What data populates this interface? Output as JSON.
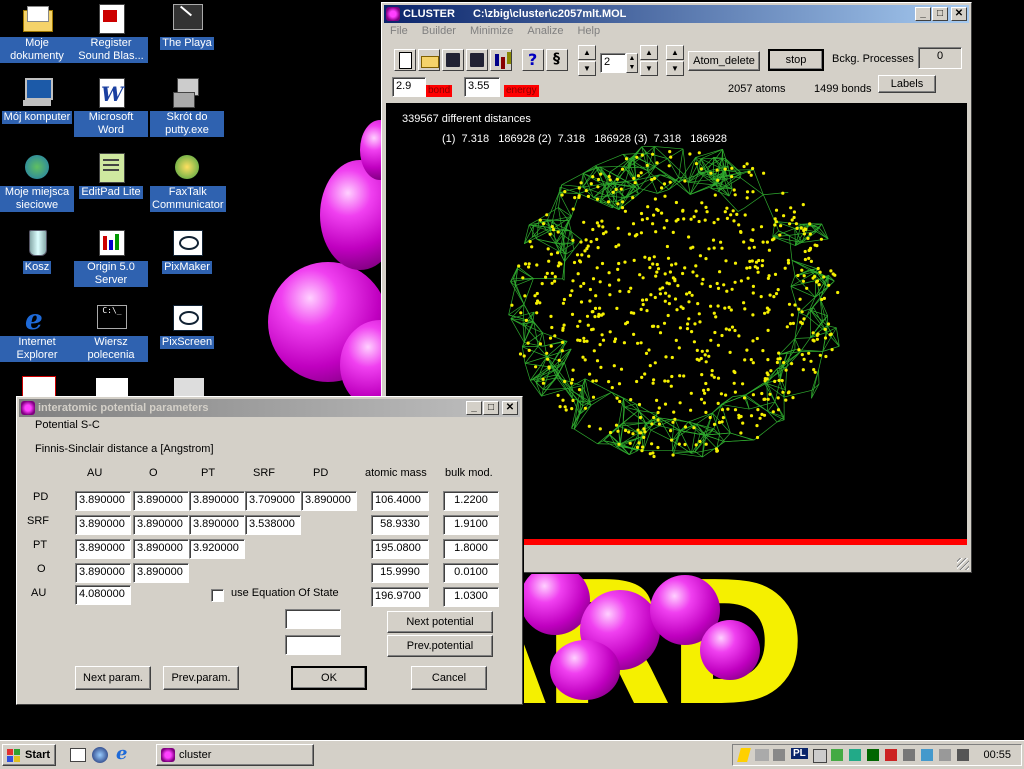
{
  "desktop": {
    "icons": [
      {
        "label": "Moje dokumenty"
      },
      {
        "label": "Register Sound Blas..."
      },
      {
        "label": "The Playa"
      },
      {
        "label": "Mój komputer"
      },
      {
        "label": "Microsoft Word"
      },
      {
        "label": "Skrót do putty.exe"
      },
      {
        "label": "Moje miejsca sieciowe"
      },
      {
        "label": "EditPad Lite"
      },
      {
        "label": "FaxTalk Communicator"
      },
      {
        "label": "Kosz"
      },
      {
        "label": "Origin 5.0 Server"
      },
      {
        "label": "PixMaker"
      },
      {
        "label": "Internet Explorer"
      },
      {
        "label": "Wiersz polecenia"
      },
      {
        "label": "PixScreen"
      }
    ],
    "bg_text": "ARD"
  },
  "cluster": {
    "title": "CLUSTER",
    "path": "C:\\zbig\\cluster\\c2057mlt.MOL",
    "menu": [
      "File",
      "Builder",
      "Minimize",
      "Analize",
      "Help"
    ],
    "spin_value": "2",
    "atom_delete": "Atom_delete",
    "stop": "stop",
    "bckg_label": "Bckg. Processes",
    "bckg_value": "0",
    "labels_button": "Labels",
    "bond_value": "2.9",
    "bond_label": "bond",
    "energy_value": "3.55",
    "energy_label": "energy",
    "atoms": "2057 atoms",
    "bonds": "1499 bonds",
    "distances": "339567 different distances",
    "distance_line": "(1)  7.318   186928 (2)  7.318   186928 (3)  7.318   186928",
    "colors": {
      "bond": "#2faa2f",
      "atom": "#f5f000",
      "red": "#ff0000"
    }
  },
  "dialog": {
    "title": "interatomic potential parameters",
    "potential": "Potential S-C",
    "description": "Finnis-Sinclair distance a [Angstrom]",
    "col_headers": [
      "AU",
      "O",
      "PT",
      "SRF",
      "PD"
    ],
    "mass_header": "atomic mass",
    "bulk_header": "bulk mod.",
    "rows": [
      {
        "label": "PD",
        "cells": [
          "3.890000",
          "3.890000",
          "3.890000",
          "3.709000",
          "3.890000"
        ],
        "mass": "106.4000",
        "bulk": "1.2200"
      },
      {
        "label": "SRF",
        "cells": [
          "3.890000",
          "3.890000",
          "3.890000",
          "3.538000"
        ],
        "mass": "58.9330",
        "bulk": "1.9100"
      },
      {
        "label": "PT",
        "cells": [
          "3.890000",
          "3.890000",
          "3.920000"
        ],
        "mass": "195.0800",
        "bulk": "1.8000"
      },
      {
        "label": "O",
        "cells": [
          "3.890000",
          "3.890000"
        ],
        "mass": "15.9990",
        "bulk": "0.0100"
      },
      {
        "label": "AU",
        "cells": [
          "4.080000"
        ],
        "mass": "196.9700",
        "bulk": "1.0300"
      }
    ],
    "eos_label": "use Equation Of State",
    "next_potential": "Next potential",
    "prev_potential": "Prev.potential",
    "next_param": "Next param.",
    "prev_param": "Prev.param.",
    "ok": "OK",
    "cancel": "Cancel"
  },
  "taskbar": {
    "start": "Start",
    "task": "cluster",
    "clock": "00:55",
    "lang": "PL"
  }
}
